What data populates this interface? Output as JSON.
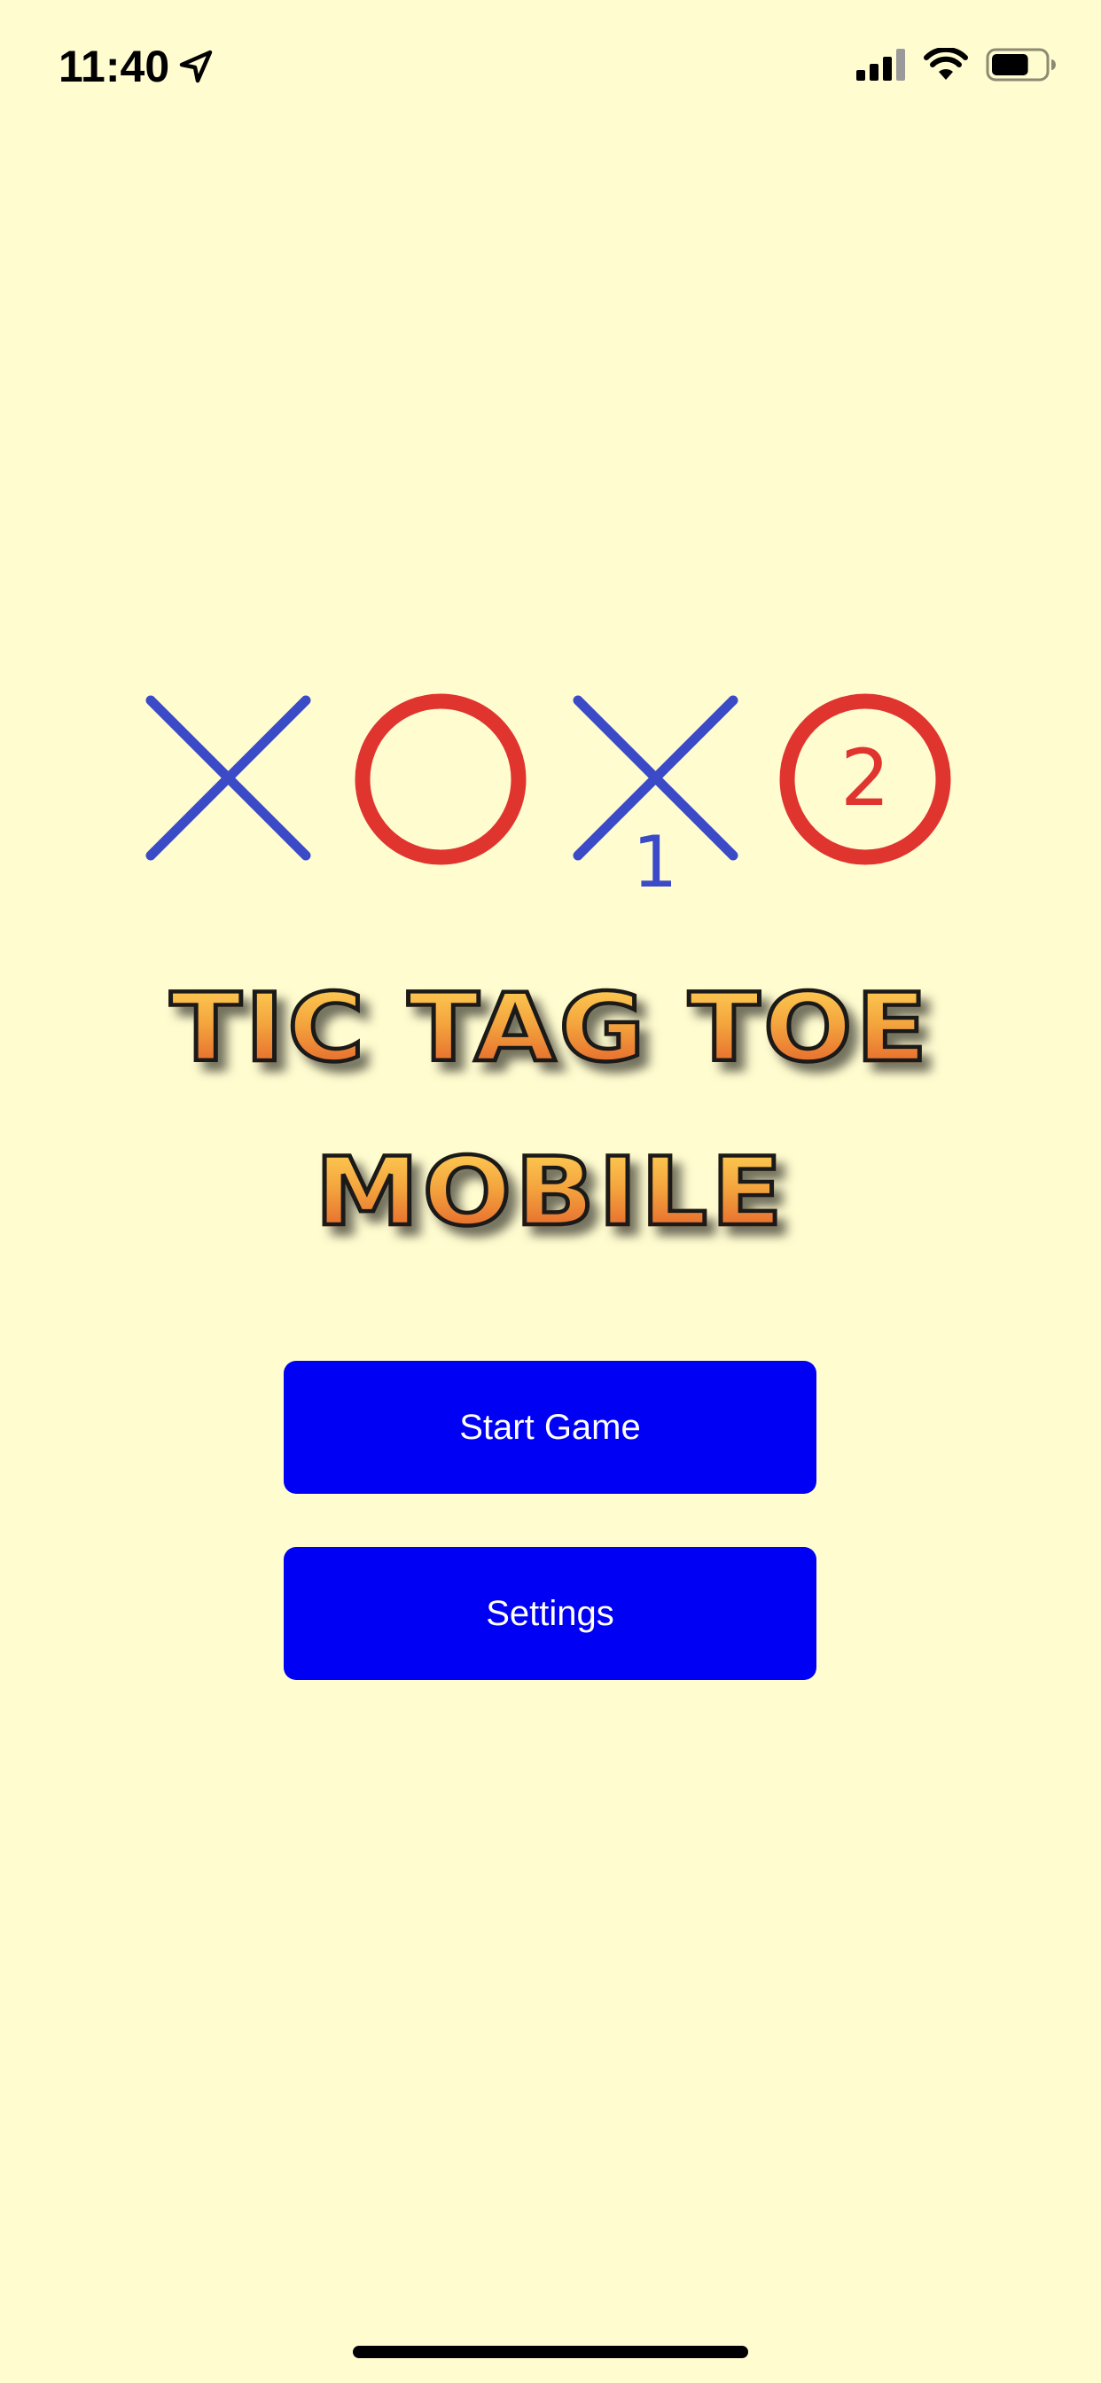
{
  "status_bar": {
    "time": "11:40",
    "location_icon": "location-arrow-icon",
    "signal_icon": "cellular-signal-icon",
    "wifi_icon": "wifi-icon",
    "battery_icon": "battery-icon",
    "battery_level_fraction": 0.7
  },
  "logo": {
    "marks": [
      "X",
      "O",
      "X",
      "O"
    ],
    "player_one_label": "1",
    "player_two_label": "2",
    "x_color": "#3B4BC8",
    "o_color": "#E0342F"
  },
  "title": {
    "line1": "TIC TAG TOE",
    "line2": "MOBILE"
  },
  "menu": {
    "start_label": "Start Game",
    "settings_label": "Settings",
    "button_color": "#0000F4"
  },
  "theme": {
    "background": "#FFFCD0"
  }
}
